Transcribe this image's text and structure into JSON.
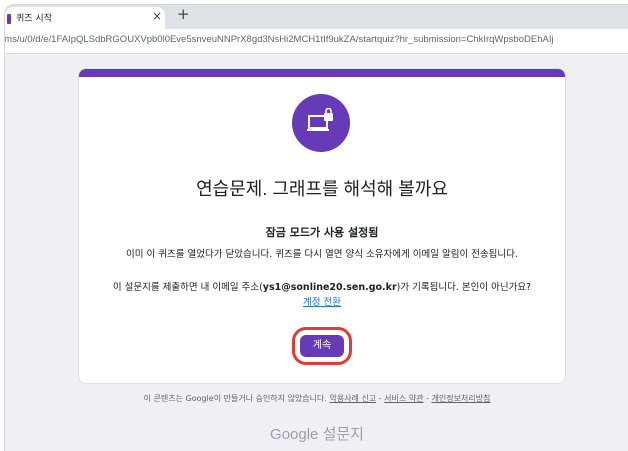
{
  "browser": {
    "tab_title": "퀴즈 시작",
    "tab_close": "×",
    "new_tab": "+",
    "url": "rms/u/0/d/e/1FAIpQLSdbRGOUXVpb0l0Eve5snveuNNPrX8gd3NsHi2MCH1tIf9ukZA/startquiz?hr_submission=ChkIrqWpsboDEhAIj"
  },
  "card": {
    "title": "연습문제. 그래프를 해석해 볼까요",
    "subtitle": "잠금 모드가 사용 설정됨",
    "notice": "이미 이 퀴즈를 열었다가 닫았습니다. 퀴즈를 다시 열면 양식 소유자에게 이메일 알림이 전송됩니다.",
    "email_prefix": "이 설문지를 제출하면 내 이메일 주소(",
    "email": "ys1@sonline20.sen.go.kr",
    "email_suffix": ")가 기록됩니다. 본인이 아닌가요?",
    "switch_account": "계정 전환",
    "continue_label": "계속"
  },
  "footer": {
    "text": "이 콘텐츠는 Google이 만들거나 승인하지 않았습니다.",
    "link_report": "악용사례 신고",
    "sep1": " - ",
    "link_terms": "서비스 약관",
    "sep2": " - ",
    "link_privacy": "개인정보처리방침",
    "brand": "Google 설문지"
  },
  "colors": {
    "accent": "#673ab7",
    "highlight": "#e53935",
    "link": "#1a73e8"
  },
  "icons": {
    "lock_icon": "laptop-lock-icon"
  }
}
